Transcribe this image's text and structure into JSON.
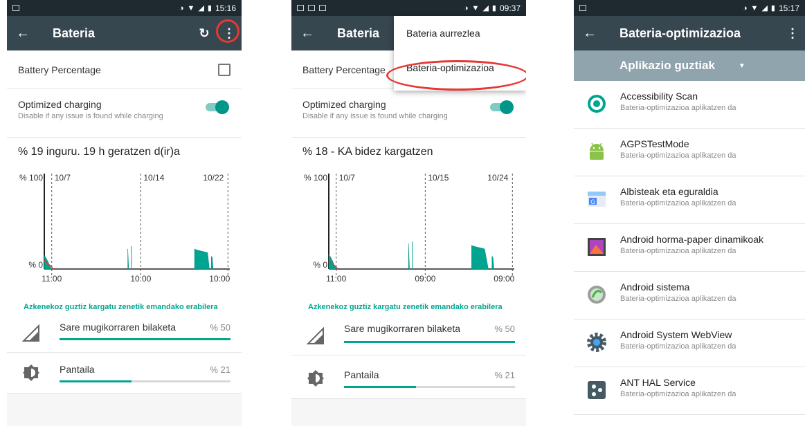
{
  "colors": {
    "statusbar": "#1e2a30",
    "toolbar": "#37474f",
    "accent": "#009688",
    "spinner": "#90a4ae",
    "highlight": "#e53935"
  },
  "screen1": {
    "status_time": "15:16",
    "toolbar": {
      "title": "Bateria",
      "back_icon": "arrow-left-icon",
      "refresh_icon": "refresh-icon",
      "menu_icon": "more-vert-icon"
    },
    "battery_percentage": {
      "label": "Battery Percentage",
      "checked": false
    },
    "optimized_charging": {
      "title": "Optimized charging",
      "subtitle": "Disable if any issue is found while charging",
      "enabled": true
    },
    "headline": "% 19 inguru. 19 h geratzen d(ir)a",
    "chart_data": {
      "type": "area",
      "ylabels": [
        "% 100",
        "% 0"
      ],
      "ylim": [
        0,
        100
      ],
      "dates": [
        "10/7",
        "10/14",
        "10/22"
      ],
      "xticks": [
        "11:00",
        "10:00",
        "10:00"
      ],
      "series": [
        {
          "x": [
            0,
            1,
            2,
            3,
            4
          ],
          "values": [
            15,
            12,
            8,
            3,
            0
          ]
        },
        {
          "x": [
            45,
            45.5
          ],
          "values": [
            22,
            0
          ]
        },
        {
          "x": [
            47
          ],
          "values": [
            25
          ]
        },
        {
          "x": [
            81,
            82,
            84,
            86,
            88,
            89
          ],
          "values": [
            22,
            21,
            20,
            19,
            18,
            0
          ]
        },
        {
          "x": [
            90,
            90.5,
            91
          ],
          "values": [
            14,
            13,
            0
          ]
        }
      ]
    },
    "since_label": "Azkenekoz guztiz kargatu zenetik emandako erabilera",
    "usage": [
      {
        "label": "Sare mugikorraren bilaketa",
        "percent": "% 50",
        "fraction": 1.0,
        "icon": "cell-signal-icon"
      },
      {
        "label": "Pantaila",
        "percent": "% 21",
        "fraction": 0.42,
        "icon": "brightness-icon"
      }
    ]
  },
  "screen2": {
    "status_time": "09:37",
    "toolbar": {
      "title": "Bateria",
      "back_icon": "arrow-left-icon"
    },
    "battery_percentage": {
      "label": "Battery Percentage"
    },
    "optimized_charging": {
      "title": "Optimized charging",
      "subtitle": "Disable if any issue is found while charging",
      "enabled": true
    },
    "headline": "% 18 - KA bidez kargatzen",
    "menu": [
      "Bateria aurrezlea",
      "Bateria-optimizazioa"
    ],
    "chart_data": {
      "type": "area",
      "ylabels": [
        "% 100",
        "% 0"
      ],
      "ylim": [
        0,
        100
      ],
      "dates": [
        "10/7",
        "10/15",
        "10/24"
      ],
      "xticks": [
        "11:00",
        "09:00",
        "09:00"
      ],
      "series": [
        {
          "x": [
            0,
            1,
            2,
            3,
            4
          ],
          "values": [
            16,
            13,
            9,
            4,
            0
          ]
        },
        {
          "x": [
            43,
            43.5
          ],
          "values": [
            28,
            0
          ]
        },
        {
          "x": [
            45
          ],
          "values": [
            30
          ]
        },
        {
          "x": [
            77,
            78,
            80,
            82,
            84,
            86
          ],
          "values": [
            26,
            25,
            24,
            23,
            22,
            0
          ]
        },
        {
          "x": [
            88,
            88.5,
            89
          ],
          "values": [
            14,
            13,
            0
          ]
        }
      ]
    },
    "since_label": "Azkenekoz guztiz kargatu zenetik emandako erabilera",
    "usage": [
      {
        "label": "Sare mugikorraren bilaketa",
        "percent": "% 50",
        "fraction": 1.0,
        "icon": "cell-signal-icon"
      },
      {
        "label": "Pantaila",
        "percent": "% 21",
        "fraction": 0.42,
        "icon": "brightness-icon"
      }
    ]
  },
  "screen3": {
    "status_time": "15:17",
    "toolbar": {
      "title": "Bateria-optimizazioa",
      "back_icon": "arrow-left-icon",
      "menu_icon": "more-vert-icon"
    },
    "filter": {
      "selected": "Aplikazio guztiak",
      "icon": "dropdown-arrow-icon"
    },
    "apps": [
      {
        "name": "Accessibility Scan",
        "status": "Bateria-optimizazioa aplikatzen da",
        "icon": "accessibility-scan-icon"
      },
      {
        "name": "AGPSTestMode",
        "status": "Bateria-optimizazioa aplikatzen da",
        "icon": "android-robot-icon"
      },
      {
        "name": "Albisteak eta eguraldia",
        "status": "Bateria-optimizazioa aplikatzen da",
        "icon": "news-weather-icon"
      },
      {
        "name": "Android horma-paper dinamikoak",
        "status": "Bateria-optimizazioa aplikatzen da",
        "icon": "live-wallpaper-icon"
      },
      {
        "name": "Android sistema",
        "status": "Bateria-optimizazioa aplikatzen da",
        "icon": "android-system-icon"
      },
      {
        "name": "Android System WebView",
        "status": "Bateria-optimizazioa aplikatzen da",
        "icon": "webview-gear-icon"
      },
      {
        "name": "ANT HAL Service",
        "status": "Bateria-optimizazioa aplikatzen da",
        "icon": "ant-hal-icon"
      }
    ]
  }
}
